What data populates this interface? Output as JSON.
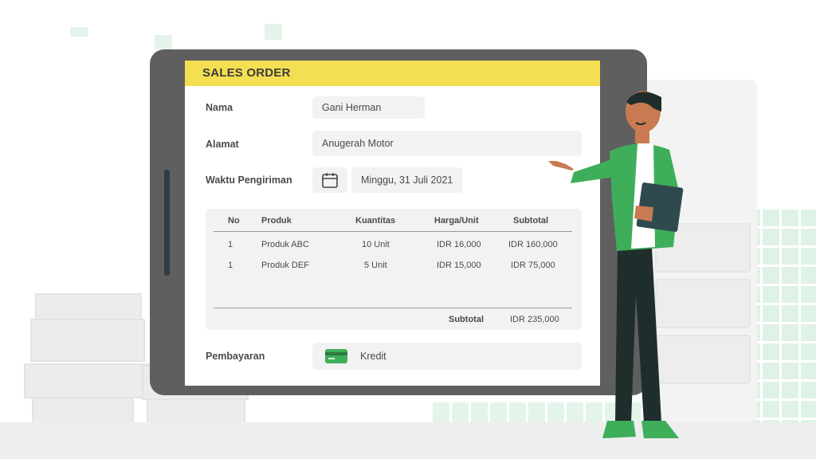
{
  "form": {
    "title": "SALES ORDER",
    "nama": {
      "label": "Nama",
      "value": "Gani Herman"
    },
    "alamat": {
      "label": "Alamat",
      "value": "Anugerah Motor"
    },
    "waktu": {
      "label": "Waktu Pengiriman",
      "value": "Minggu, 31 Juli 2021",
      "icon": "calendar-icon"
    },
    "table": {
      "headers": [
        "No",
        "Produk",
        "Kuantitas",
        "Harga/Unit",
        "Subtotal"
      ],
      "rows": [
        [
          "1",
          "Produk ABC",
          "10 Unit",
          "IDR 16,000",
          "IDR 160,000"
        ],
        [
          "1",
          "Produk DEF",
          "5 Unit",
          "IDR 15,000",
          "IDR 75,000"
        ]
      ],
      "subtotal_label": "Subtotal",
      "subtotal_value": "IDR 235,000"
    },
    "pembayaran": {
      "label": "Pembayaran",
      "value": "Kredit",
      "icon": "credit-card-icon"
    }
  },
  "colors": {
    "header": "#f4df52",
    "tablet": "#5f5f5f",
    "accent_green": "#3fae5a"
  }
}
